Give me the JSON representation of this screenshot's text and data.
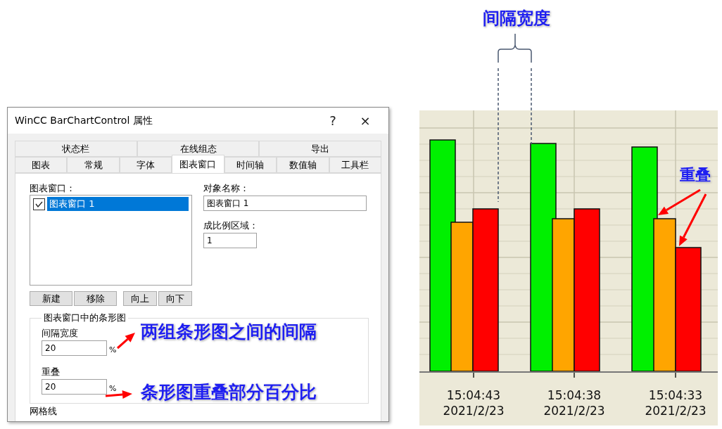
{
  "dialog": {
    "title": "WinCC BarChartControl 属性",
    "help": "?",
    "close": "×",
    "tab_rows": [
      [
        {
          "label": "状态栏",
          "selected": false
        },
        {
          "label": "在线组态",
          "selected": false
        },
        {
          "label": "导出",
          "selected": false
        }
      ],
      [
        {
          "label": "图表",
          "selected": false
        },
        {
          "label": "常规",
          "selected": false
        },
        {
          "label": "字体",
          "selected": false
        },
        {
          "label": "图表窗口",
          "selected": true
        },
        {
          "label": "时间轴",
          "selected": false
        },
        {
          "label": "数值轴",
          "selected": false
        },
        {
          "label": "工具栏",
          "selected": false
        }
      ]
    ],
    "chart_windows_label": "图表窗口：",
    "chart_windows": [
      {
        "label": "图表窗口 1",
        "checked": true,
        "selected": true
      }
    ],
    "object_name_label": "对象名称：",
    "object_name": "图表窗口 1",
    "scale_label": "成比例区域：",
    "scale": "1",
    "buttons": [
      "新建",
      "移除",
      "向上",
      "向下"
    ],
    "bar_group": {
      "title": "图表窗口中的条形图",
      "gap_label": "间隔宽度",
      "gap": "20",
      "gap_unit": "%",
      "overlap_label": "重叠",
      "overlap": "20",
      "overlap_unit": "%"
    },
    "gridlines_label": "网格线"
  },
  "annotations": {
    "gap_note": "两组条形图之间的间隔",
    "overlap_note": "条形图重叠部分百分比",
    "gap_width_callout": "间隔宽度",
    "overlap_callout": "重叠"
  },
  "chart": {
    "axis_labels": [
      {
        "time": "15:04:43",
        "date": "2021/2/23"
      },
      {
        "time": "15:04:38",
        "date": "2021/2/23"
      },
      {
        "time": "15:04:33",
        "date": "2021/2/23"
      }
    ]
  }
}
